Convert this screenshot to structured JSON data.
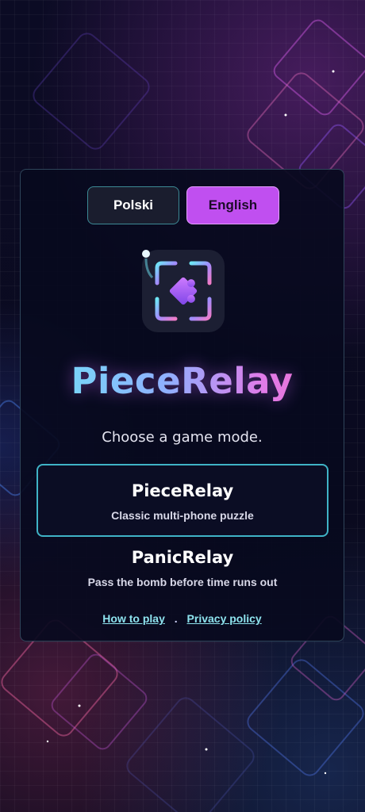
{
  "language_switch": {
    "polish_label": "Polski",
    "english_label": "English",
    "selected": "English"
  },
  "logo": {
    "icon": "puzzle-piece-icon"
  },
  "app_title": "PieceRelay",
  "prompt": "Choose a game mode.",
  "modes": [
    {
      "name": "PieceRelay",
      "description": "Classic multi-phone puzzle",
      "selected": true
    },
    {
      "name": "PanicRelay",
      "description": "Pass the bomb before time runs out",
      "selected": false
    }
  ],
  "footer": {
    "how_to_play": "How to play",
    "separator": ".",
    "privacy_policy": "Privacy policy"
  },
  "colors": {
    "background": "#0a0a1f",
    "accent_purple": "#c04ff0",
    "accent_cyan": "#3fb3c6",
    "link": "#8ee3ee"
  }
}
